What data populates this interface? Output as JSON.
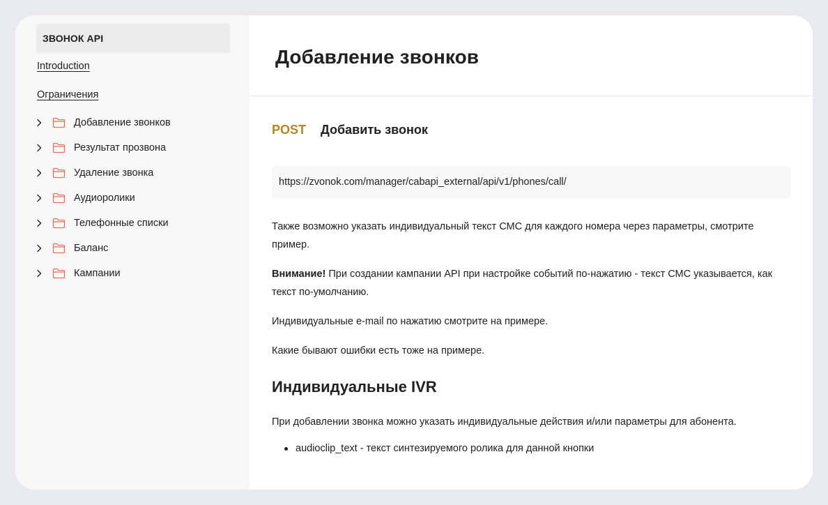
{
  "colors": {
    "page_bg": "#e9eaf0",
    "sidebar_bg": "#f8f8f8",
    "method_post": "#b7861f",
    "folder_icon": "#e57260"
  },
  "sidebar": {
    "header": "ЗВОНОК API",
    "links": [
      {
        "label": "Introduction"
      },
      {
        "label": "Ограничения"
      }
    ],
    "folders": [
      {
        "label": "Добавление звонков",
        "icon": "folder-icon"
      },
      {
        "label": "Результат прозвона",
        "icon": "folder-icon"
      },
      {
        "label": "Удаление звонка",
        "icon": "folder-icon"
      },
      {
        "label": "Аудиоролики",
        "icon": "folder-icon"
      },
      {
        "label": "Телефонные списки",
        "icon": "folder-icon"
      },
      {
        "label": "Баланс",
        "icon": "folder-icon"
      },
      {
        "label": "Кампании",
        "icon": "folder-icon"
      }
    ]
  },
  "main": {
    "title": "Добавление звонков",
    "request": {
      "method": "POST",
      "name": "Добавить звонок",
      "url": "https://zvonok.com/manager/cabapi_external/api/v1/phones/call/"
    },
    "paragraphs": {
      "p1": "Также возможно указать индивидуальный текст СМС для каждого номера через параметры, смотрите пример.",
      "p2_bold": "Внимание!",
      "p2_rest": " При создании кампании API при настройке событий по-нажатию - текст СМС указывается, как текст по-умолчанию.",
      "p3": "Индивидуальные e-mail по нажатию смотрите на примере.",
      "p4": "Какие бывают ошибки есть тоже на примере."
    },
    "section": {
      "title": "Индивидуальные IVR",
      "intro": "При добавлении звонка можно указать индивидуальные действия и/или параметры для абонента.",
      "bullets": [
        {
          "text": "audioclip_text - текст синтезируемого ролика для данной кнопки"
        }
      ]
    }
  }
}
